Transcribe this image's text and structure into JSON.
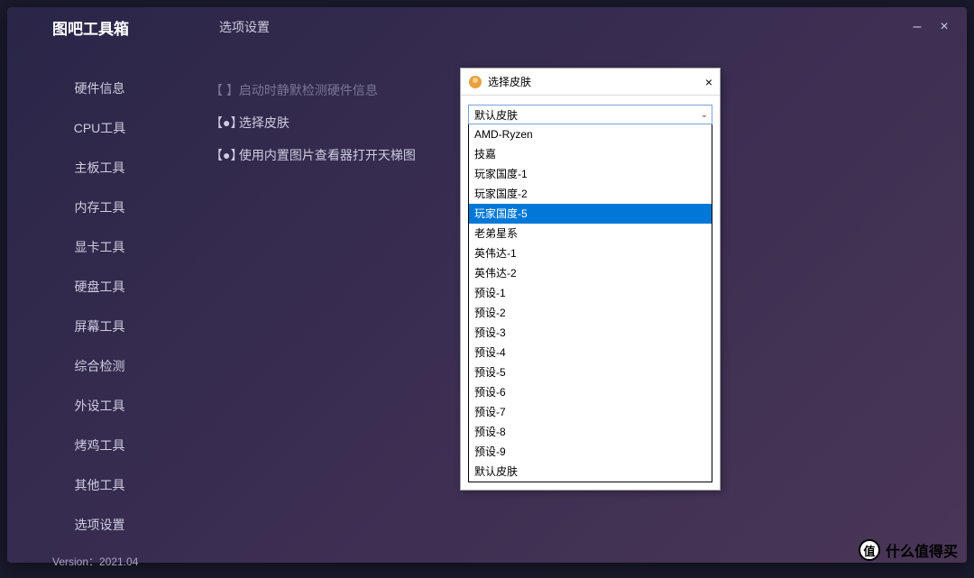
{
  "app": {
    "title": "图吧工具箱",
    "page_title": "选项设置"
  },
  "window_controls": {
    "minimize": "–",
    "close": "×"
  },
  "sidebar": {
    "items": [
      {
        "label": "硬件信息"
      },
      {
        "label": "CPU工具"
      },
      {
        "label": "主板工具"
      },
      {
        "label": "内存工具"
      },
      {
        "label": "显卡工具"
      },
      {
        "label": "硬盘工具"
      },
      {
        "label": "屏幕工具"
      },
      {
        "label": "综合检测"
      },
      {
        "label": "外设工具"
      },
      {
        "label": "烤鸡工具"
      },
      {
        "label": "其他工具"
      },
      {
        "label": "选项设置"
      }
    ],
    "version_label": "Version：2021.04"
  },
  "options": {
    "row1": {
      "marker": "【   】",
      "label": "启动时静默检测硬件信息",
      "disabled": true
    },
    "row2": {
      "marker": "【●】",
      "label": "选择皮肤",
      "disabled": false
    },
    "row3": {
      "marker": "【●】",
      "label": "使用内置图片查看器打开天梯图",
      "disabled": false
    }
  },
  "popup": {
    "title": "选择皮肤",
    "close": "×",
    "selected": "默认皮肤",
    "highlighted_index": 4,
    "items": [
      "AMD-Ryzen",
      "技嘉",
      "玩家国度-1",
      "玩家国度-2",
      "玩家国度-5",
      "老弟星系",
      "英伟达-1",
      "英伟达-2",
      "预设-1",
      "预设-2",
      "预设-3",
      "预设-4",
      "预设-5",
      "预设-6",
      "预设-7",
      "预设-8",
      "预设-9",
      "默认皮肤"
    ]
  },
  "watermark": {
    "badge": "值",
    "text": "什么值得买"
  }
}
